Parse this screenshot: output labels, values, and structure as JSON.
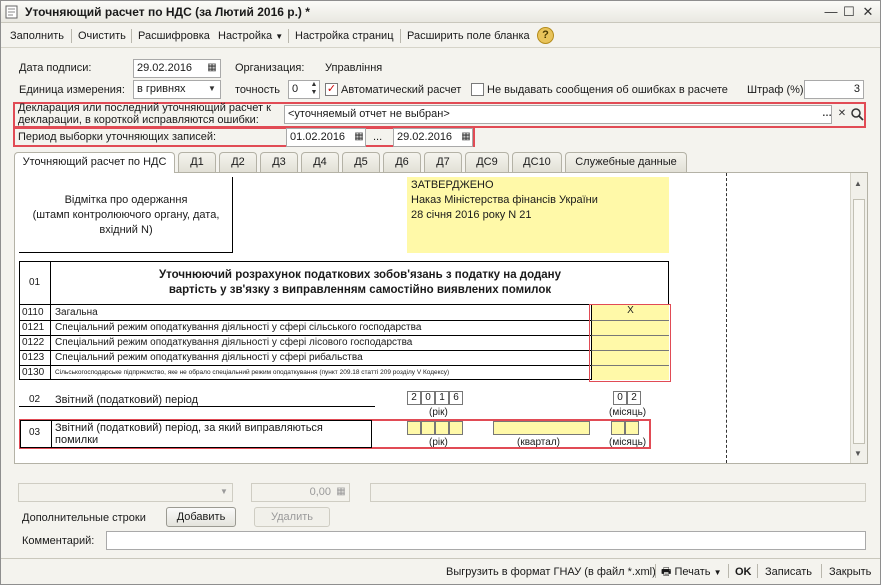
{
  "window": {
    "title": "Уточняющий расчет по НДС (за Лютий 2016 р.) *",
    "controls": {
      "minimize": "—",
      "maximize": "☐",
      "close": "✕"
    }
  },
  "toolbar": {
    "fill": "Заполнить",
    "clear": "Очистить",
    "decode": "Расшифровка",
    "settings": "Настройка",
    "page_setup": "Настройка страниц",
    "expand_form": "Расширить поле бланка",
    "help": "?"
  },
  "form": {
    "sign_date_label": "Дата подписи:",
    "sign_date": "29.02.2016",
    "org_label": "Организация:",
    "org_value": "Управління",
    "unit_label": "Единица измерения:",
    "unit_value": "в гривнях",
    "precision_label": "точность",
    "precision_value": "0",
    "auto_calc_label": "Автоматический расчет",
    "auto_calc_checked": true,
    "no_errors_label": "Не выдавать сообщения об ошибках в расчете",
    "no_errors_checked": false,
    "fine_label": "Штраф (%):",
    "fine_value": "3",
    "declaration_label": "Декларация или последний уточняющий расчет к декларации, в короткой исправляются ошибки:",
    "declaration_value": "<уточняемый отчет не выбран>",
    "period_label": "Период выборки уточняющих записей:",
    "period_from": "01.02.2016",
    "period_sep": "...",
    "period_to": "29.02.2016"
  },
  "tabs": [
    "Уточняющий расчет по НДС",
    "Д1",
    "Д2",
    "Д3",
    "Д4",
    "Д5",
    "Д6",
    "Д7",
    "ДС9",
    "ДС10",
    "Служебные данные"
  ],
  "document": {
    "stamp_text": "Відмітка про одержання\n(штамп контролюючого органу, дата,\nвхідний N)",
    "approved_1": "ЗАТВЕРДЖЕНО",
    "approved_2": "Наказ Міністерства фінансів України",
    "approved_3": "28 січня 2016 року N 21",
    "row01_code": "01",
    "heading_1": "Уточнюючий розрахунок податкових зобов'язань з податку на додану",
    "heading_2": "вартість у зв'язку з виправленням самостійно виявлених помилок",
    "rows": [
      {
        "code": "0110",
        "text": "Загальна",
        "mark": "X"
      },
      {
        "code": "0121",
        "text": "Спеціальний режим оподаткування діяльності у сфері сільського господарства",
        "mark": ""
      },
      {
        "code": "0122",
        "text": "Спеціальний режим оподаткування діяльності у сфері лісового господарства",
        "mark": ""
      },
      {
        "code": "0123",
        "text": "Спеціальний режим оподаткування діяльності у сфері рибальства",
        "mark": ""
      },
      {
        "code": "0130",
        "text": "Сільськогосподарське підприємство, яке не обрало спеціальний режим оподаткування (пункт 209.18 статті 209 розділу V Кодексу)",
        "mark": ""
      }
    ],
    "row02_code": "02",
    "row02_text": "Звітний (податковий) період",
    "year_digits": [
      "2",
      "0",
      "1",
      "6"
    ],
    "year_label": "(рік)",
    "month_digits": [
      "0",
      "2"
    ],
    "month_label": "(місяць)",
    "row03_code": "03",
    "row03_text": "Звітний (податковий) період, за який виправляються помилки",
    "quarter_label": "(квартал)"
  },
  "bottom": {
    "amount": "0,00",
    "extra_rows_label": "Дополнительные строки",
    "add_button": "Добавить",
    "delete_button": "Удалить",
    "comment_label": "Комментарий:",
    "comment_value": ""
  },
  "statusbar": {
    "export": "Выгрузить в формат ГНАУ (в файл *.xml)",
    "print": "Печать",
    "ok": "OK",
    "save": "Записать",
    "close": "Закрыть"
  },
  "colors": {
    "highlight_border": "#e14b55",
    "input_yellow": "#fff9a8"
  }
}
